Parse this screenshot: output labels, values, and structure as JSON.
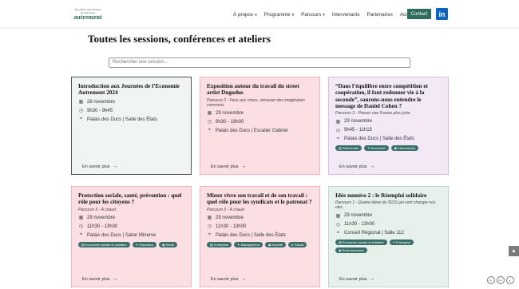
{
  "header": {
    "logo_small": "10e édition des journées",
    "logo_small2": "de l'économie",
    "logo_big": "autrement",
    "nav": [
      {
        "label": "À propos",
        "dropdown": true
      },
      {
        "label": "Programme",
        "dropdown": true
      },
      {
        "label": "Parcours",
        "dropdown": true
      },
      {
        "label": "Intervenants",
        "dropdown": false
      },
      {
        "label": "Partenaires",
        "dropdown": false
      },
      {
        "label": "Accès",
        "dropdown": false
      }
    ],
    "contact_label": "Contact",
    "linkedin_label": "in"
  },
  "page": {
    "title": "Toutes les sessions, conférences et ateliers",
    "search_placeholder": "Rechercher une session..."
  },
  "cards": [
    {
      "title": "Introduction aux Journées de l’Economie Autrement 2024",
      "parcours": "",
      "date": "28 novembre",
      "time": "9h30 - 9h45",
      "place": "Palais des Ducs | Salle des États",
      "tags": [],
      "more": "En savoir plus"
    },
    {
      "title": "Exposition autour du travail du street artist Dugudus",
      "parcours": "Parcours 2 - Face aux crises, retrouver des imaginaires communs",
      "date": "29 novembre",
      "time": "9h30 - 19h00",
      "place": "Palais des Ducs | Escalier Gabriel",
      "tags": [],
      "more": "En savoir plus"
    },
    {
      "title": "“Dans l’équilibre entre compétition et coopération, il faut redonner vie à la seconde”, saurons-nous entendre le message de Daniel Cohen ?",
      "parcours": "Parcours 2 - Penser une France plus juste",
      "date": "29 novembre",
      "time": "9h45 - 11h15",
      "place": "Palais des Ducs | Salle des États",
      "tags": [
        "Démocratie",
        "Economie",
        "International"
      ],
      "more": "En savoir plus"
    },
    {
      "title": "Protection sociale, santé, prévention : quel rôle pour les citoyens ?",
      "parcours": "Parcours 5 - À chaud",
      "date": "29 novembre",
      "time": "11h30 - 13h00",
      "place": "Palais des Ducs | Salon Minerve",
      "tags": [
        "Economie sociale et solidaire",
        "Education",
        "Santé"
      ],
      "more": "En savoir plus"
    },
    {
      "title": "Mieux vivre son travail et de son travail : quel rôle pour les syndicats et le patronat ?",
      "parcours": "Parcours 5 - À chaud",
      "date": "29 novembre",
      "time": "11h30 - 13h00",
      "place": "Palais des Ducs | Salle des États",
      "tags": [
        "Entreprise",
        "Management",
        "Société",
        "Travail"
      ],
      "more": "En savoir plus"
    },
    {
      "title": "Idée numéro 2 : le Réemploi solidaire",
      "parcours": "Parcours 1 - Quatre idées de l'ESS qui vont changer nos vies",
      "date": "29 novembre",
      "time": "11h30 - 13h00",
      "place": "Conseil Régional | Salle 112",
      "tags": [
        "Economie sociale et solidaire",
        "Entreprise",
        "Environnement"
      ],
      "more": "En savoir plus"
    }
  ],
  "accessibility": [
    "A-",
    "A+",
    "◐"
  ],
  "colors": {
    "brand": "#2f6e5f",
    "linkedin": "#0a66c2",
    "tag": "#3b6f6a"
  }
}
